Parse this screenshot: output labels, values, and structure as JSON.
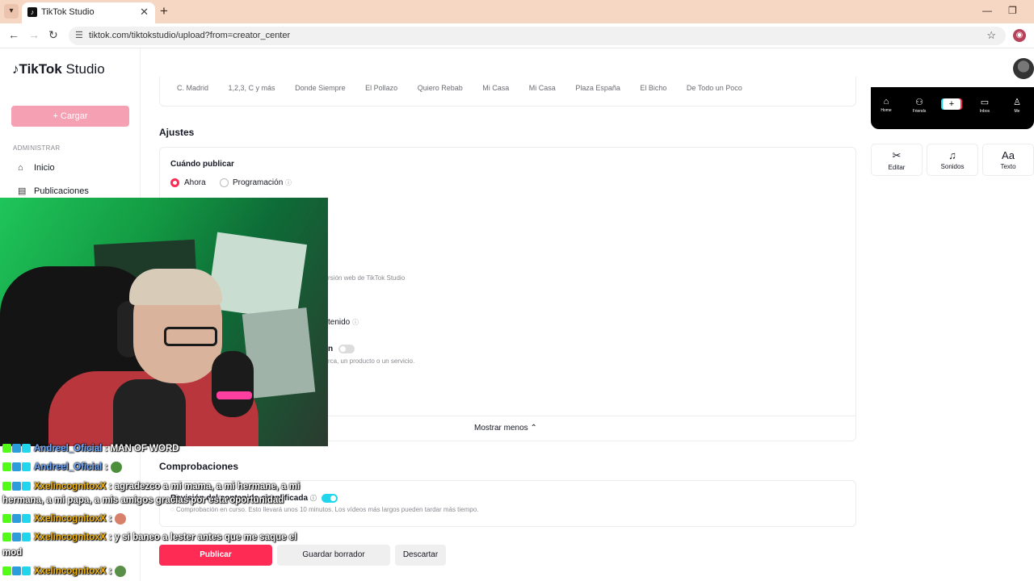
{
  "browser": {
    "tab_title": "TikTok Studio",
    "url": "tiktok.com/tiktokstudio/upload?from=creator_center"
  },
  "header": {
    "logo_main": "TikTok",
    "logo_sub": "Studio"
  },
  "sidebar": {
    "upload_label": "+ Cargar",
    "section_label": "ADMINISTRAR",
    "items": [
      {
        "label": "Inicio",
        "icon": "home-icon"
      },
      {
        "label": "Publicaciones",
        "icon": "posts-icon"
      }
    ]
  },
  "main": {
    "location_chips": [
      "C. Madrid",
      "1,2,3, C y más",
      "Donde Siempre",
      "El Pollazo",
      "Quiero Rebab",
      "Mi Casa",
      "Mi Casa",
      "Plaza España",
      "El Bicho",
      "De Todo un Poco"
    ],
    "settings_title": "Ajustes",
    "when_publish_label": "Cuándo publicar",
    "radio_now": "Ahora",
    "radio_schedule": "Programación",
    "partial_web_text": "rsión web de TikTok Studio",
    "partial_content_label": "tenido",
    "partial_toggle_label": "n",
    "partial_brand_text": "rca, un producto o un servicio.",
    "show_less": "Mostrar menos",
    "checks_title": "Comprobaciones",
    "content_review_label": "Revisión del contenido simplificada",
    "content_review_status": "Comprobación en curso. Esto llevará unos 10 minutos. Los vídeos más largos pueden tardar más tiempo.",
    "publish_button": "Publicar",
    "draft_button": "Guardar borrador",
    "discard_button": "Descartar"
  },
  "preview": {
    "nav": [
      {
        "label": "Home",
        "icon": "home-icon"
      },
      {
        "label": "Friends",
        "icon": "friends-icon"
      },
      {
        "label": "Inbox",
        "icon": "inbox-icon"
      },
      {
        "label": "Me",
        "icon": "profile-icon"
      }
    ],
    "tools": [
      {
        "label": "Editar",
        "icon": "scissors-icon"
      },
      {
        "label": "Sonidos",
        "icon": "music-note-icon"
      },
      {
        "label": "Texto",
        "icon": "text-icon"
      }
    ]
  },
  "chat": [
    {
      "user": "Andreel_Oficial",
      "message": ": MAN OF WORD"
    },
    {
      "user": "Andreel_Oficial",
      "message": ":"
    },
    {
      "user": "XxelincognitoxX",
      "message": ": agradezco a mi mama, a mi hermane, a mi",
      "continuation": "hermana, a mi papa, a mis amigos gracias por esta oportunidad"
    },
    {
      "user": "XxelincognitoxX",
      "message": ":"
    },
    {
      "user": "XxelincognitoxX",
      "message": ": y si baneo a lester antes que me saque el",
      "continuation": "mod"
    },
    {
      "user": "XxelincognitoxX",
      "message": ":"
    }
  ],
  "colors": {
    "accent": "#fe2c55",
    "upload_button": "#f6a0b4",
    "toggle_on": "#20d5ec"
  }
}
